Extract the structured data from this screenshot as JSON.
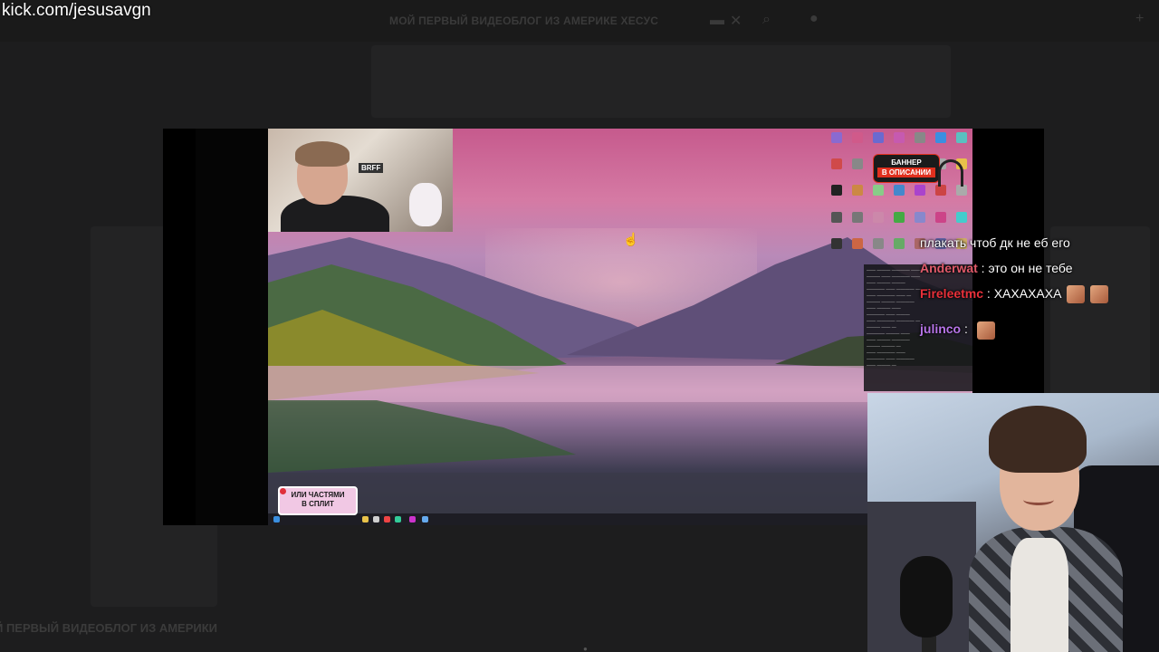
{
  "watermark": "kick.com/jesusavgn",
  "background_page": {
    "top_title": "МОЙ ПЕРВЫЙ ВИДЕОБЛОГ ИЗ АМЕРИКЕ ХЕСУС",
    "bottom_title": "Й ПЕРВЫЙ ВИДЕОБЛОГ ИЗ АМЕРИКИ"
  },
  "banner": {
    "line1": "БАННЕР",
    "line2": "В ОПИСАНИИ"
  },
  "sticker": {
    "line1": "ИЛИ ЧАСТЯМИ",
    "line2": "В СПЛИТ"
  },
  "webcam_small": {
    "shelf_label": "BRFF"
  },
  "chat": [
    {
      "user": "",
      "text": "плакать чтоб дк не еб его",
      "color": "#ffffff",
      "emotes": 0
    },
    {
      "user": "Anderwat",
      "text": " : это он не тебе",
      "color": "#e05a6a",
      "emotes": 0
    },
    {
      "user": "Fireleetmc",
      "text": " : ХАХАХАХА",
      "color": "#e8303a",
      "emotes": 2
    },
    {
      "user": "julinco",
      "text": " : ",
      "color": "#b774e8",
      "emotes": 1
    }
  ],
  "colors": {
    "page_bg": "#1b1b1c",
    "desktop_sky": "#c65a8d",
    "banner_red": "#e0301e",
    "sticker_pink": "#f1c8e4"
  }
}
